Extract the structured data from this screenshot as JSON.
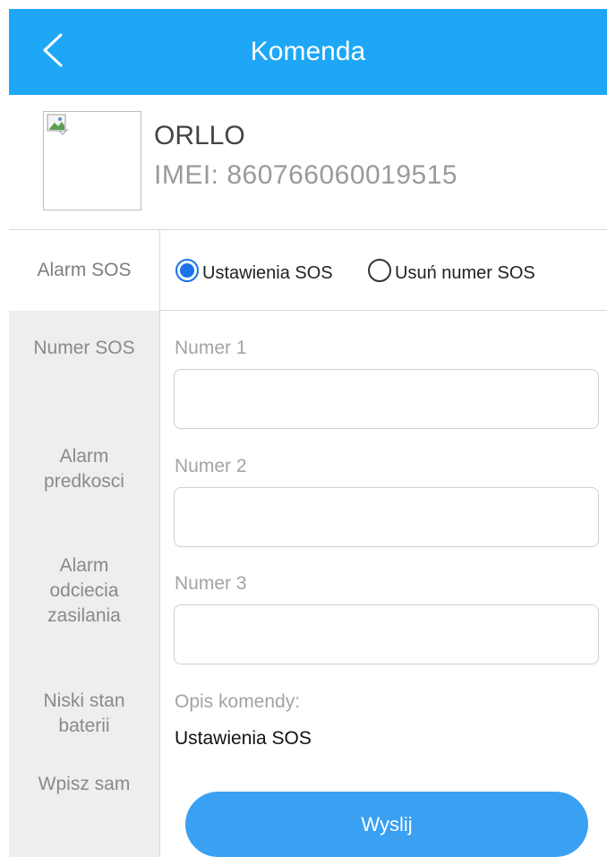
{
  "header": {
    "title": "Komenda",
    "back_icon": "chevron-left-icon",
    "background": "#1ea7f6"
  },
  "device": {
    "name": "ORLLO",
    "imei": "IMEI:  860766060019515",
    "image_icon": "broken-image-icon"
  },
  "sidebar": {
    "items": [
      {
        "label": "Alarm SOS",
        "active": true
      },
      {
        "label": "Numer SOS",
        "active": false
      },
      {
        "label": "Alarm\npredkosci",
        "active": false
      },
      {
        "label": "Alarm\nodciecia\nzasilania",
        "active": false
      },
      {
        "label": "Niski stan\nbaterii",
        "active": false
      },
      {
        "label": "Wpisz sam",
        "active": false
      }
    ]
  },
  "mode": {
    "options": [
      {
        "label": "Ustawienia SOS",
        "selected": true
      },
      {
        "label": "Usuń numer SOS",
        "selected": false
      }
    ]
  },
  "fields": [
    {
      "label": "Numer 1",
      "value": ""
    },
    {
      "label": "Numer 2",
      "value": ""
    },
    {
      "label": "Numer 3",
      "value": ""
    }
  ],
  "description": {
    "label": "Opis komendy:",
    "value": "Ustawienia SOS"
  },
  "send": {
    "label": "Wyslij",
    "color": "#3aa0f2"
  }
}
